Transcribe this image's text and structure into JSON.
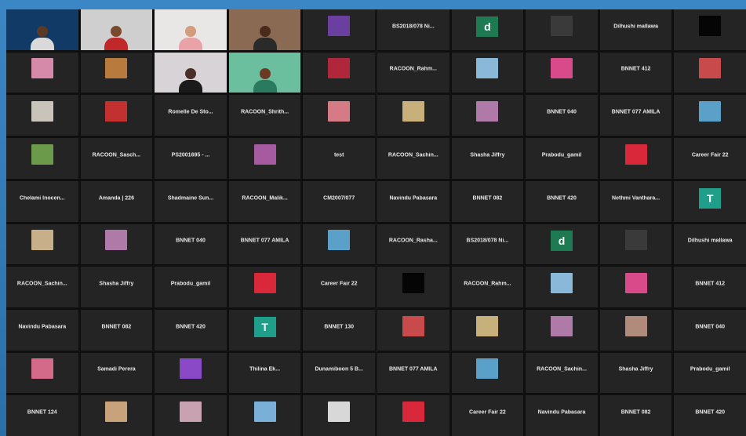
{
  "meeting": {
    "left_tiles": [
      {
        "kind": "video",
        "bg": "#123a66",
        "skin": "#5a3a22",
        "shirt": "#d9d9d9",
        "active": true
      },
      {
        "kind": "video",
        "bg": "#cfcfcf",
        "skin": "#7a4a2e",
        "shirt": "#c0282a"
      },
      {
        "kind": "video",
        "bg": "#e9e6e6",
        "skin": "#d29c7d",
        "shirt": "#e8a2a8"
      },
      {
        "kind": "video",
        "bg": "#8a6a52",
        "skin": "#4a2a1a",
        "shirt": "#2a2a2a"
      },
      {
        "kind": "thumb",
        "color": "#6b3fa0"
      },
      {
        "kind": "thumb",
        "color": "#d48aa8"
      },
      {
        "kind": "thumb",
        "color": "#b97a3e"
      },
      {
        "kind": "video",
        "bg": "#d7d3d7",
        "skin": "#4a2e28",
        "shirt": "#1a1a1a"
      },
      {
        "kind": "video",
        "bg": "#6bbf9e",
        "skin": "#6a3a22",
        "shirt": "#2a7a60"
      },
      {
        "kind": "thumb",
        "color": "#b0263a"
      },
      {
        "kind": "thumb",
        "color": "#c9c4b9"
      },
      {
        "kind": "thumb",
        "color": "#c23030"
      },
      {
        "kind": "name",
        "name": "Romelle De Sto..."
      },
      {
        "kind": "name",
        "name": "RACOON_Shrith..."
      },
      {
        "kind": "thumb",
        "color": "#d67a86"
      },
      {
        "kind": "thumb",
        "color": "#6a9a4a"
      },
      {
        "kind": "name",
        "name": "RACOON_Sasch..."
      },
      {
        "kind": "name",
        "name": "PS2001695 - ..."
      },
      {
        "kind": "thumb",
        "color": "#a65aa0"
      },
      {
        "kind": "name",
        "name": "test"
      },
      {
        "kind": "name",
        "name": "Chelami Inocen..."
      },
      {
        "kind": "name",
        "name": "Amanda | 226"
      },
      {
        "kind": "name",
        "name": "Shadmaine Sun..."
      },
      {
        "kind": "name",
        "name": "RACOON_Malik..."
      },
      {
        "kind": "name",
        "name": "CM2007/077"
      },
      {
        "kind": "thumb",
        "color": "#c7b089"
      },
      {
        "kind": "thumb",
        "color": "#b07aa8"
      },
      {
        "kind": "name",
        "name": "BNNET 040"
      },
      {
        "kind": "name",
        "name": "BNNET 077 AMILA"
      },
      {
        "kind": "thumb",
        "color": "#5aa0c8"
      },
      {
        "kind": "name",
        "name": "RACOON_Sachin..."
      },
      {
        "kind": "name",
        "name": "Shasha Jiffry"
      },
      {
        "kind": "name",
        "name": "Prabodu_gamil"
      },
      {
        "kind": "thumb",
        "color": "#d8283a"
      },
      {
        "kind": "name",
        "name": "Career Fair 22"
      },
      {
        "kind": "name",
        "name": "Navindu Pabasara"
      },
      {
        "kind": "name",
        "name": "BNNET 082"
      },
      {
        "kind": "name",
        "name": "BNNET 420"
      },
      {
        "kind": "avatar",
        "letter": "T",
        "color": "#1f9e8a"
      },
      {
        "kind": "name",
        "name": "BNNET 130"
      },
      {
        "kind": "thumb",
        "color": "#d46a8a"
      },
      {
        "kind": "name",
        "name": "Samadi Perera"
      },
      {
        "kind": "thumb",
        "color": "#8a4ac8"
      },
      {
        "kind": "name",
        "name": "Thilina Ek..."
      },
      {
        "kind": "name",
        "name": "Dunamiboon 5 B..."
      },
      {
        "kind": "name",
        "name": "BNNET 124"
      },
      {
        "kind": "thumb",
        "color": "#c8a27a"
      },
      {
        "kind": "thumb",
        "color": "#c8a2b0"
      },
      {
        "kind": "thumb",
        "color": "#7ab0d8"
      },
      {
        "kind": "thumb",
        "color": "#d8d8d8"
      }
    ],
    "right_tiles": [
      {
        "kind": "name",
        "name": "BS2018/078 Ni..."
      },
      {
        "kind": "avatar",
        "letter": "d",
        "color": "#1d7a52"
      },
      {
        "kind": "thumb",
        "color": "#3a3a3a"
      },
      {
        "kind": "name",
        "name": "Dilhushi mallawa"
      },
      {
        "kind": "thumb",
        "color": "#050505"
      },
      {
        "kind": "name",
        "name": "RACOON_Rahm..."
      },
      {
        "kind": "thumb",
        "color": "#8ab8d8"
      },
      {
        "kind": "thumb",
        "color": "#d84a8a"
      },
      {
        "kind": "name",
        "name": "BNNET 412"
      },
      {
        "kind": "thumb",
        "color": "#c84a4a"
      },
      {
        "kind": "thumb",
        "color": "#c8b07a"
      },
      {
        "kind": "thumb",
        "color": "#b07aa8"
      },
      {
        "kind": "name",
        "name": "BNNET 040"
      },
      {
        "kind": "name",
        "name": "BNNET 077 AMILA"
      },
      {
        "kind": "thumb",
        "color": "#5aa0c8"
      },
      {
        "kind": "name",
        "name": "RACOON_Sachin..."
      },
      {
        "kind": "name",
        "name": "Shasha Jiffry"
      },
      {
        "kind": "name",
        "name": "Prabodu_gamil"
      },
      {
        "kind": "thumb",
        "color": "#d8283a"
      },
      {
        "kind": "name",
        "name": "Career Fair 22"
      },
      {
        "kind": "name",
        "name": "Navindu Pabasara"
      },
      {
        "kind": "name",
        "name": "BNNET 082"
      },
      {
        "kind": "name",
        "name": "BNNET 420"
      },
      {
        "kind": "name",
        "name": "Nethmi Vanthara..."
      },
      {
        "kind": "avatar",
        "letter": "T",
        "color": "#1f9e8a"
      },
      {
        "kind": "name",
        "name": "RACOON_Rasha..."
      },
      {
        "kind": "name",
        "name": "BS2018/078 Ni..."
      },
      {
        "kind": "avatar",
        "letter": "d",
        "color": "#1d7a52"
      },
      {
        "kind": "thumb",
        "color": "#3a3a3a"
      },
      {
        "kind": "name",
        "name": "Dilhushi mallawa"
      },
      {
        "kind": "thumb",
        "color": "#050505"
      },
      {
        "kind": "name",
        "name": "RACOON_Rahm..."
      },
      {
        "kind": "thumb",
        "color": "#8ab8d8"
      },
      {
        "kind": "thumb",
        "color": "#d84a8a"
      },
      {
        "kind": "name",
        "name": "BNNET 412"
      },
      {
        "kind": "thumb",
        "color": "#c84a4a"
      },
      {
        "kind": "thumb",
        "color": "#c8b07a"
      },
      {
        "kind": "thumb",
        "color": "#b07aa8"
      },
      {
        "kind": "thumb",
        "color": "#b08a7a"
      },
      {
        "kind": "name",
        "name": "BNNET 040"
      },
      {
        "kind": "name",
        "name": "BNNET 077 AMILA"
      },
      {
        "kind": "thumb",
        "color": "#5aa0c8"
      },
      {
        "kind": "name",
        "name": "RACOON_Sachin..."
      },
      {
        "kind": "name",
        "name": "Shasha Jiffry"
      },
      {
        "kind": "name",
        "name": "Prabodu_gamil"
      },
      {
        "kind": "thumb",
        "color": "#d8283a"
      },
      {
        "kind": "name",
        "name": "Career Fair 22"
      },
      {
        "kind": "name",
        "name": "Navindu Pabasara"
      },
      {
        "kind": "name",
        "name": "BNNET 082"
      },
      {
        "kind": "name",
        "name": "BNNET 420"
      }
    ]
  }
}
